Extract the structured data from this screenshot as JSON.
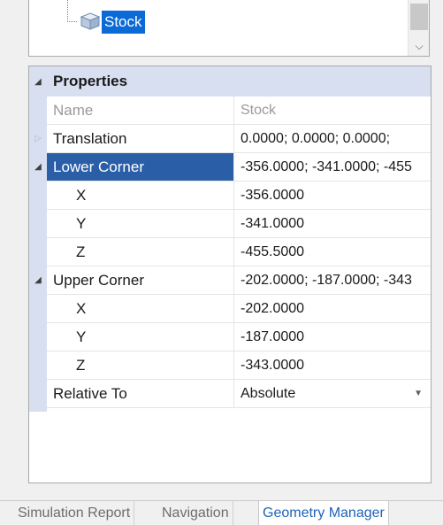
{
  "tree": {
    "selected_item": "Stock",
    "icon": "stock-box-icon"
  },
  "properties": {
    "category_label": "Properties",
    "rows": [
      {
        "name": "Name",
        "value": "Stock"
      },
      {
        "name": "Translation",
        "value": "0.0000; 0.0000; 0.0000;"
      },
      {
        "name": "Lower Corner",
        "value": "-356.0000; -341.0000; -455"
      },
      {
        "name": "X",
        "value": "-356.0000"
      },
      {
        "name": "Y",
        "value": "-341.0000"
      },
      {
        "name": "Z",
        "value": "-455.5000"
      },
      {
        "name": "Upper Corner",
        "value": "-202.0000; -187.0000; -343"
      },
      {
        "name": "X",
        "value": "-202.0000"
      },
      {
        "name": "Y",
        "value": "-187.0000"
      },
      {
        "name": "Z",
        "value": "-343.0000"
      },
      {
        "name": "Relative To",
        "value": "Absolute"
      }
    ]
  },
  "tabs": [
    {
      "label": "Simulation Report",
      "active": false
    },
    {
      "label": "Navigation",
      "active": false
    },
    {
      "label": "Geometry Manager",
      "active": true
    }
  ],
  "colors": {
    "selection": "#0b6bd6",
    "category_band": "#d7dff0",
    "active_tab_text": "#1e63b8"
  }
}
